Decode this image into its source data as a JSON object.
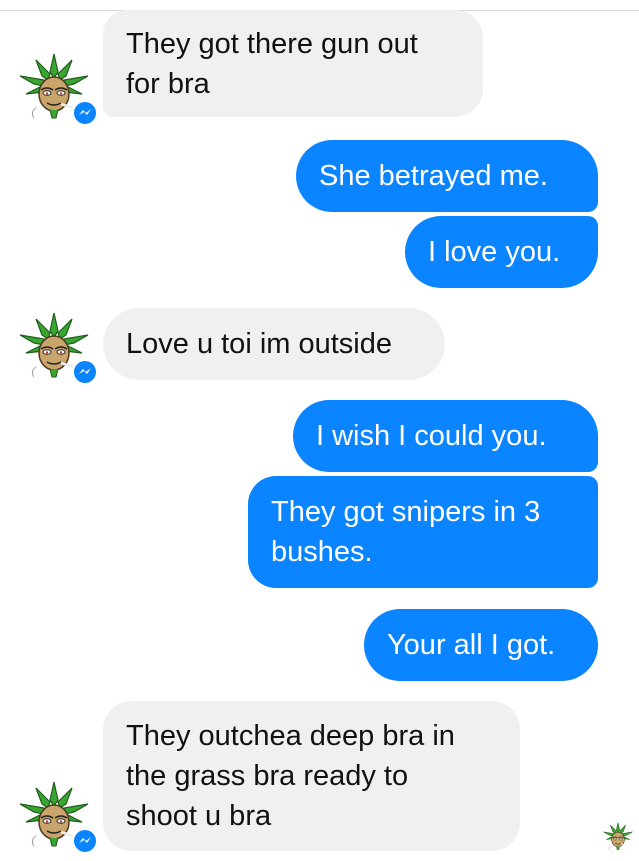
{
  "colors": {
    "outgoing_bubble": "#0b84ff",
    "incoming_bubble": "#f1f0f0",
    "messenger_badge": "#0b84ff",
    "avatar_leaf": "#3aa632"
  },
  "contact": {
    "avatar_icon": "cannabis-leaf-face-avatar-icon",
    "badge_icon": "messenger-badge-icon"
  },
  "messages": [
    {
      "direction": "incoming",
      "text": "They got there gun out\nfor bra"
    },
    {
      "direction": "outgoing",
      "text": "She betrayed me."
    },
    {
      "direction": "outgoing",
      "text": "I love you."
    },
    {
      "direction": "incoming",
      "text": "Love u toi im outside"
    },
    {
      "direction": "outgoing",
      "text": "I wish I could you."
    },
    {
      "direction": "outgoing",
      "text": "They got snipers in 3\nbushes."
    },
    {
      "direction": "outgoing",
      "text": "Your all I got."
    },
    {
      "direction": "incoming",
      "text": "They outchea deep bra in\nthe grass bra ready to\nshoot u bra"
    }
  ],
  "read_receipt": {
    "icon": "seen-avatar-icon"
  }
}
